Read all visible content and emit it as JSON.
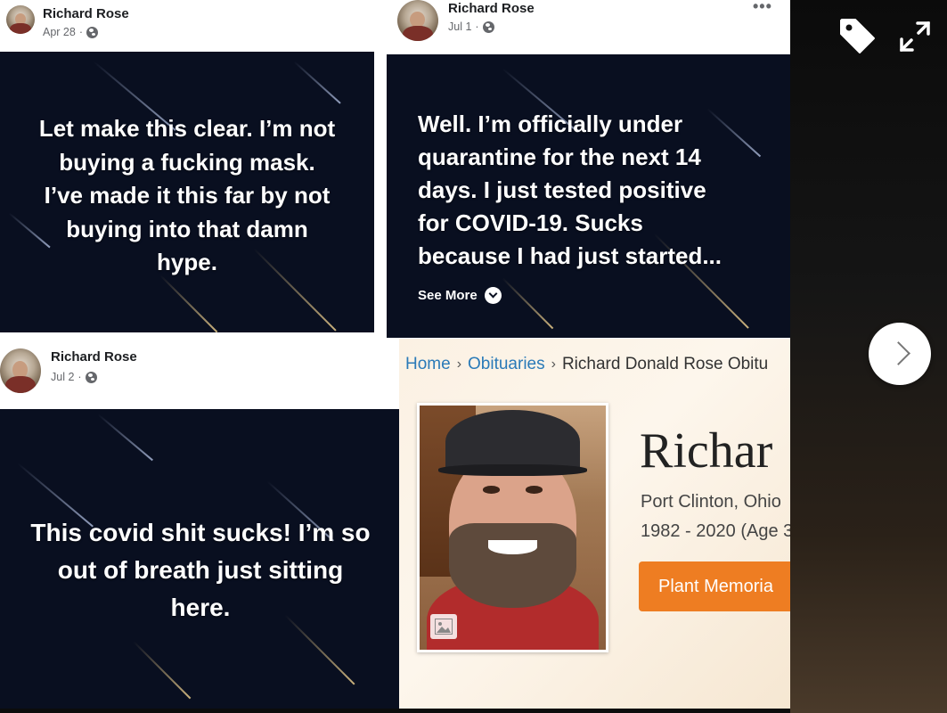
{
  "posts": [
    {
      "author": "Richard Rose",
      "date": "Apr 28",
      "sep": "·",
      "text_lines": [
        "Let make this clear. I’m not",
        "buying a fucking mask.",
        "I’ve made it this far by not",
        "buying into that damn",
        "hype."
      ]
    },
    {
      "author": "Richard Rose",
      "date": "Jul 1",
      "sep": "·",
      "more_icon": "•••",
      "text_lines": [
        "Well. I’m officially under",
        "quarantine for the next 14",
        "days. I just tested positive",
        "for COVID-19. Sucks",
        "because I had just started..."
      ],
      "see_more": "See More"
    },
    {
      "author": "Richard Rose",
      "date": "Jul 2",
      "sep": "·",
      "text_lines": [
        "This covid shit sucks! I’m so",
        "out of breath just sitting",
        "here."
      ]
    }
  ],
  "obituary": {
    "breadcrumb": {
      "home": "Home",
      "obituaries": "Obituaries",
      "current": "Richard Donald Rose Obitu",
      "sep": "›"
    },
    "name": "Richar",
    "location": "Port Clinton, Ohio",
    "years": "1982 - 2020 (Age 3",
    "button": "Plant Memoria"
  },
  "controls": {
    "tag_icon": "tag-icon",
    "expand_icon": "expand-icon",
    "next_icon": "chevron-right-icon"
  },
  "colors": {
    "card_bg": "#090f20",
    "link": "#2a7ab8",
    "button": "#ee7d22"
  }
}
